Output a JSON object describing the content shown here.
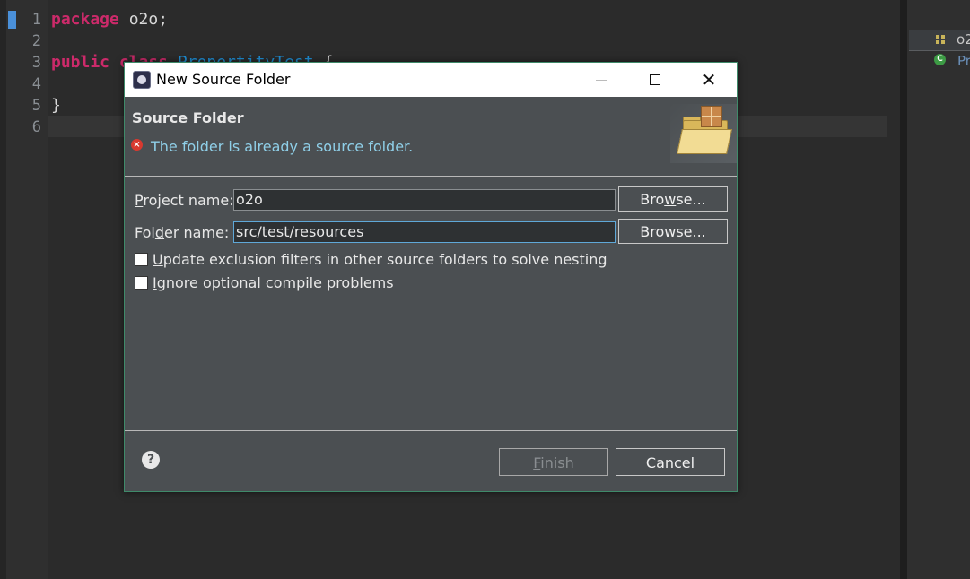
{
  "editor": {
    "line_numbers": [
      "1",
      "2",
      "3",
      "4",
      "5",
      "6"
    ],
    "lines": {
      "l1_kw": "package",
      "l1_rest": " o2o;",
      "l3_kw": "public",
      "l3_kw2": " class ",
      "l3_cls": "PropertityTest",
      "l3_rest": " {",
      "l5": "}"
    }
  },
  "outline": {
    "item1": "o2",
    "item2": "Pr"
  },
  "dialog": {
    "title": "New Source Folder",
    "close_glyph": "✕",
    "banner_title": "Source Folder",
    "error_message": "The folder is already a source folder.",
    "project_label": {
      "pre": "",
      "mnemonic": "P",
      "post": "roject name:"
    },
    "project_value": "o2o",
    "folder_label": {
      "pre": "Fol",
      "mnemonic": "d",
      "post": "er name:"
    },
    "folder_value": "src/test/resources",
    "browse1": {
      "pre": "Bro",
      "mnemonic": "w",
      "post": "se..."
    },
    "browse2": {
      "pre": "Br",
      "mnemonic": "o",
      "post": "wse..."
    },
    "checkbox1": {
      "mnemonic": "U",
      "post": "pdate exclusion filters in other source folders to solve nesting",
      "checked": false
    },
    "checkbox2": {
      "mnemonic": "I",
      "post": "gnore optional compile problems",
      "checked": false
    },
    "help_glyph": "?",
    "finish": {
      "mnemonic": "F",
      "post": "inish",
      "enabled": false
    },
    "cancel_label": "Cancel"
  },
  "colors": {
    "keyword": "#cc2a6a",
    "class_name": "#1f8fd6",
    "error_text": "#8fcfe8",
    "dialog_bg": "#4b4f52"
  }
}
